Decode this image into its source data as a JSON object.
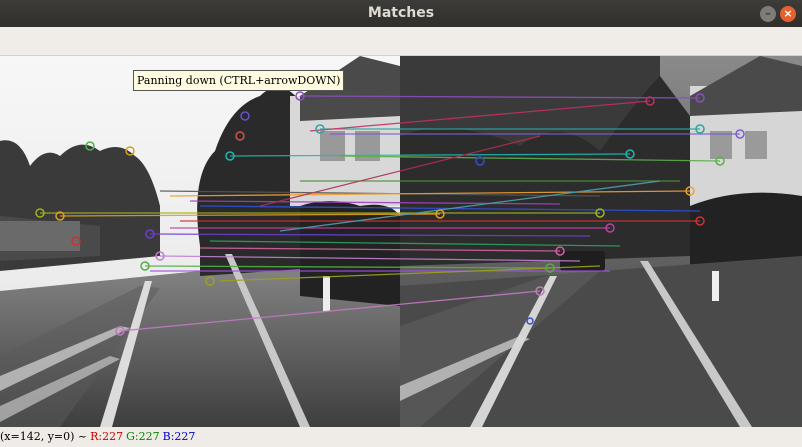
{
  "window": {
    "title": "Matches",
    "minimize_glyph": "–",
    "close_glyph": "×"
  },
  "tooltip": {
    "text": "Panning down (CTRL+arrowDOWN)"
  },
  "status": {
    "coords": "(x=142, y=0) ~",
    "r": "R:227",
    "g": "G:227",
    "b": "B:227",
    "colors": {
      "r": "#cc0000",
      "g": "#008800",
      "b": "#0000cc"
    }
  },
  "icons": [
    "minimize-icon",
    "close-icon"
  ]
}
